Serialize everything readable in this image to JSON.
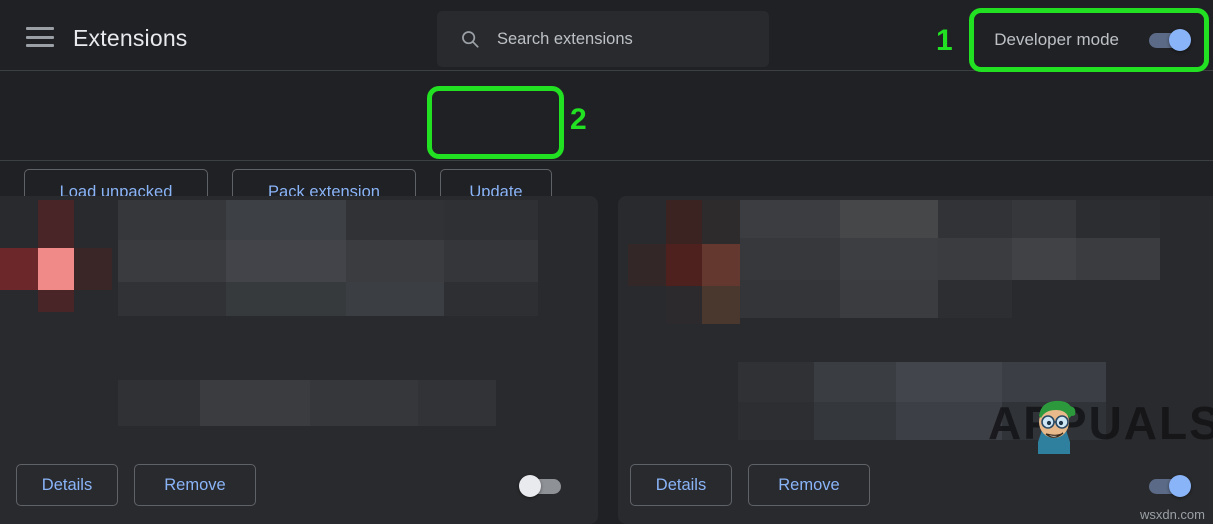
{
  "header": {
    "menu_icon": "hamburger-menu-icon",
    "title": "Extensions",
    "search": {
      "icon": "search-icon",
      "placeholder": "Search extensions",
      "value": ""
    },
    "developer_mode": {
      "label": "Developer mode",
      "state": "on"
    }
  },
  "toolbar": {
    "load_unpacked_label": "Load unpacked",
    "pack_extension_label": "Pack extension",
    "update_label": "Update"
  },
  "cards": [
    {
      "details_label": "Details",
      "remove_label": "Remove",
      "enabled_toggle_state": "off"
    },
    {
      "details_label": "Details",
      "remove_label": "Remove",
      "enabled_toggle_state": "on"
    }
  ],
  "annotations": [
    {
      "number": "1",
      "target": "developer-mode-toggle"
    },
    {
      "number": "2",
      "target": "update-button"
    }
  ],
  "watermarks": {
    "brand": "APPUALS",
    "site": "wsxdn.com"
  },
  "colors": {
    "background": "#202124",
    "card": "#292a2d",
    "accent_blue": "#8ab4f8",
    "annotation_green": "#22e022",
    "text_primary": "#e8eaed",
    "text_secondary": "#bdc1c6",
    "border": "#5f6368"
  }
}
